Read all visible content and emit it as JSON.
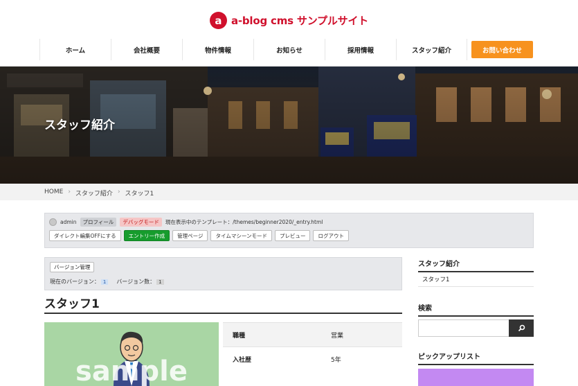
{
  "site": {
    "logo_mark": "a",
    "logo_text": "a-blog cms サンプルサイト",
    "brand_color": "#d0102c"
  },
  "nav": {
    "items": [
      {
        "label": "ホーム"
      },
      {
        "label": "会社概要"
      },
      {
        "label": "物件情報"
      },
      {
        "label": "お知らせ"
      },
      {
        "label": "採用情報"
      },
      {
        "label": "スタッフ紹介"
      }
    ],
    "cta": "お問い合わせ",
    "cta_color": "#f7921e"
  },
  "hero": {
    "title": "スタッフ紹介"
  },
  "breadcrumb": {
    "items": [
      "HOME",
      "スタッフ紹介",
      "スタッフ1"
    ],
    "separator": "›"
  },
  "admin": {
    "user": "admin",
    "profile_tag": "プロフィール",
    "debug_tag": "デバッグモード",
    "template_text": "現在表示中のテンプレート：/themes/beginner2020/_entry.html",
    "buttons": [
      "ダイレクト編集OFFにする",
      "エントリー作成",
      "管理ページ",
      "タイムマシーンモード",
      "プレビュー",
      "ログアウト"
    ]
  },
  "version": {
    "button": "バージョン管理",
    "current_label": "現在のバージョン：",
    "current_value": "1",
    "count_label": "バージョン数：",
    "count_value": "1"
  },
  "entry": {
    "title": "スタッフ1",
    "image_text": "sample",
    "table": [
      {
        "key": "職種",
        "value": "営業"
      },
      {
        "key": "入社歴",
        "value": "5年"
      }
    ]
  },
  "sidebar": {
    "staff_heading": "スタッフ紹介",
    "staff_items": [
      "スタッフ1"
    ],
    "search_heading": "検索",
    "pickup_heading": "ピックアップリスト"
  }
}
